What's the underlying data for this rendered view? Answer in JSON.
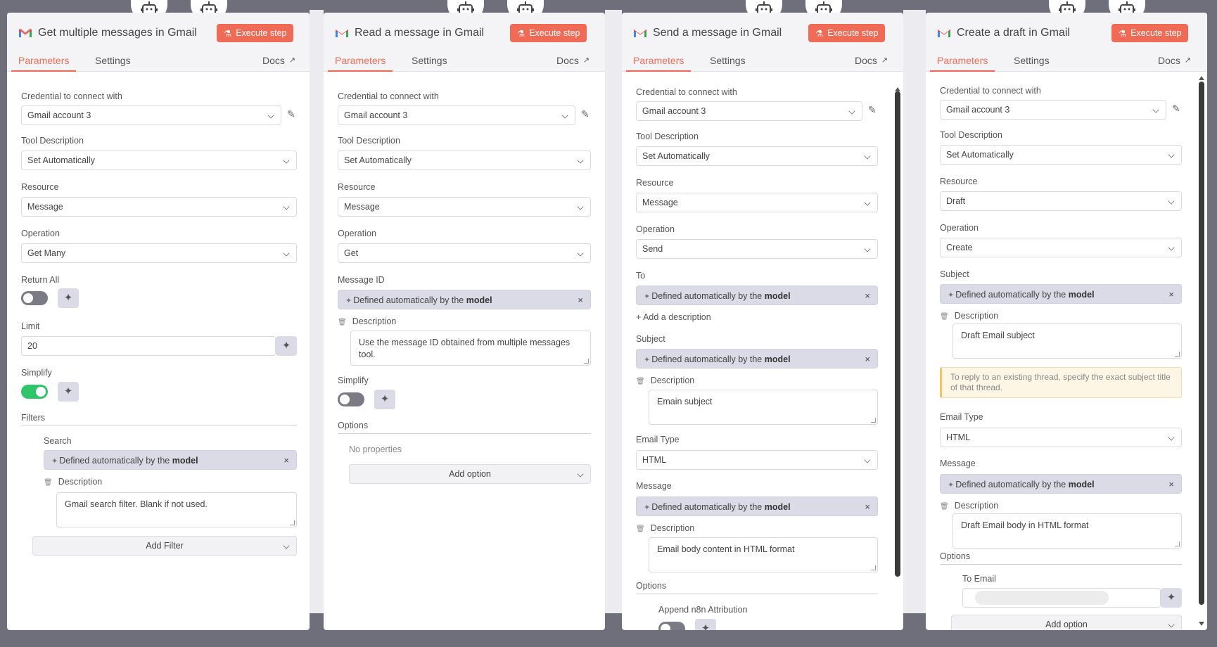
{
  "accent_color": "#f06b55",
  "toggle_on_color": "#2ec56b",
  "common": {
    "tab_parameters": "Parameters",
    "tab_settings": "Settings",
    "docs": "Docs",
    "execute": "Execute step",
    "credential_label": "Credential to connect with",
    "credential_value": "Gmail account 3",
    "tool_desc_label": "Tool Description",
    "tool_desc_value": "Set Automatically",
    "resource_label": "Resource",
    "operation_label": "Operation",
    "description_label": "Description",
    "chip_prefix": "Defined automatically by the ",
    "chip_bold": "model",
    "icons": [
      "gmail-icon",
      "robot-icon",
      "pencil-icon",
      "sparkle-icon",
      "trash-icon",
      "external-link-icon",
      "chevron-down-icon",
      "close-icon"
    ]
  },
  "panel1": {
    "title": "Get multiple messages in Gmail",
    "resource_value": "Message",
    "operation_value": "Get Many",
    "return_all_label": "Return All",
    "return_all_on": false,
    "limit_label": "Limit",
    "limit_value": "20",
    "simplify_label": "Simplify",
    "simplify_on": true,
    "filters_label": "Filters",
    "search_label": "Search",
    "search_desc": "Gmail search filter. Blank if not used.",
    "add_filter": "Add Filter"
  },
  "panel2": {
    "title": "Read a message in Gmail",
    "resource_value": "Message",
    "operation_value": "Get",
    "message_id_label": "Message ID",
    "message_id_desc": "Use the message ID obtained from multiple messages tool.",
    "simplify_label": "Simplify",
    "simplify_on": false,
    "options_label": "Options",
    "no_properties": "No properties",
    "add_option": "Add option"
  },
  "panel3": {
    "title": "Send a message in Gmail",
    "resource_value": "Message",
    "operation_value": "Send",
    "to_label": "To",
    "add_description": "+ Add a description",
    "subject_label": "Subject",
    "subject_desc": "Emain subject",
    "email_type_label": "Email Type",
    "email_type_value": "HTML",
    "message_label": "Message",
    "message_desc": "Email body content in HTML format",
    "options_label": "Options",
    "append_label": "Append n8n Attribution",
    "append_on": false
  },
  "panel4": {
    "title": "Create a draft in Gmail",
    "resource_value": "Draft",
    "operation_value": "Create",
    "subject_label": "Subject",
    "subject_desc": "Draft Email subject",
    "hint": "To reply to an existing thread, specify the exact subject title of that thread.",
    "email_type_label": "Email Type",
    "email_type_value": "HTML",
    "message_label": "Message",
    "message_desc": "Draft Email body in HTML format",
    "options_label": "Options",
    "to_email_label": "To Email",
    "add_option": "Add option"
  }
}
